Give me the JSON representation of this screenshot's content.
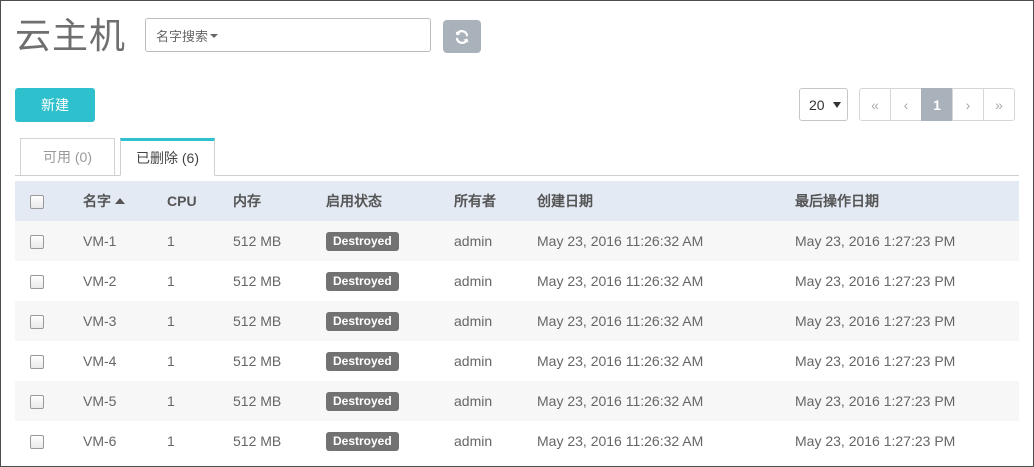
{
  "header": {
    "title": "云主机",
    "search_dropdown_label": "名字搜索"
  },
  "toolbar": {
    "new_label": "新建",
    "page_size": "20"
  },
  "pagination": [
    "«",
    "‹",
    "1",
    "›",
    "»"
  ],
  "tabs": [
    {
      "label": "可用 (0)"
    },
    {
      "label": "已删除 (6)"
    }
  ],
  "table": {
    "headers": [
      "名字",
      "CPU",
      "内存",
      "启用状态",
      "所有者",
      "创建日期",
      "最后操作日期"
    ],
    "rows": [
      {
        "name": "VM-1",
        "cpu": "1",
        "memory": "512 MB",
        "status": "Destroyed",
        "owner": "admin",
        "created": "May 23, 2016 11:26:32 AM",
        "last_op": "May 23, 2016 1:27:23 PM"
      },
      {
        "name": "VM-2",
        "cpu": "1",
        "memory": "512 MB",
        "status": "Destroyed",
        "owner": "admin",
        "created": "May 23, 2016 11:26:32 AM",
        "last_op": "May 23, 2016 1:27:23 PM"
      },
      {
        "name": "VM-3",
        "cpu": "1",
        "memory": "512 MB",
        "status": "Destroyed",
        "owner": "admin",
        "created": "May 23, 2016 11:26:32 AM",
        "last_op": "May 23, 2016 1:27:23 PM"
      },
      {
        "name": "VM-4",
        "cpu": "1",
        "memory": "512 MB",
        "status": "Destroyed",
        "owner": "admin",
        "created": "May 23, 2016 11:26:32 AM",
        "last_op": "May 23, 2016 1:27:23 PM"
      },
      {
        "name": "VM-5",
        "cpu": "1",
        "memory": "512 MB",
        "status": "Destroyed",
        "owner": "admin",
        "created": "May 23, 2016 11:26:32 AM",
        "last_op": "May 23, 2016 1:27:23 PM"
      },
      {
        "name": "VM-6",
        "cpu": "1",
        "memory": "512 MB",
        "status": "Destroyed",
        "owner": "admin",
        "created": "May 23, 2016 11:26:32 AM",
        "last_op": "May 23, 2016 1:27:23 PM"
      }
    ]
  },
  "colors": {
    "accent": "#2fc0cd",
    "header_bg": "#e3eaf4",
    "badge": "#727272",
    "muted_button": "#a9b1bb"
  },
  "icons": {
    "refresh": "refresh-icon",
    "sort": "sort-ascending-icon"
  }
}
